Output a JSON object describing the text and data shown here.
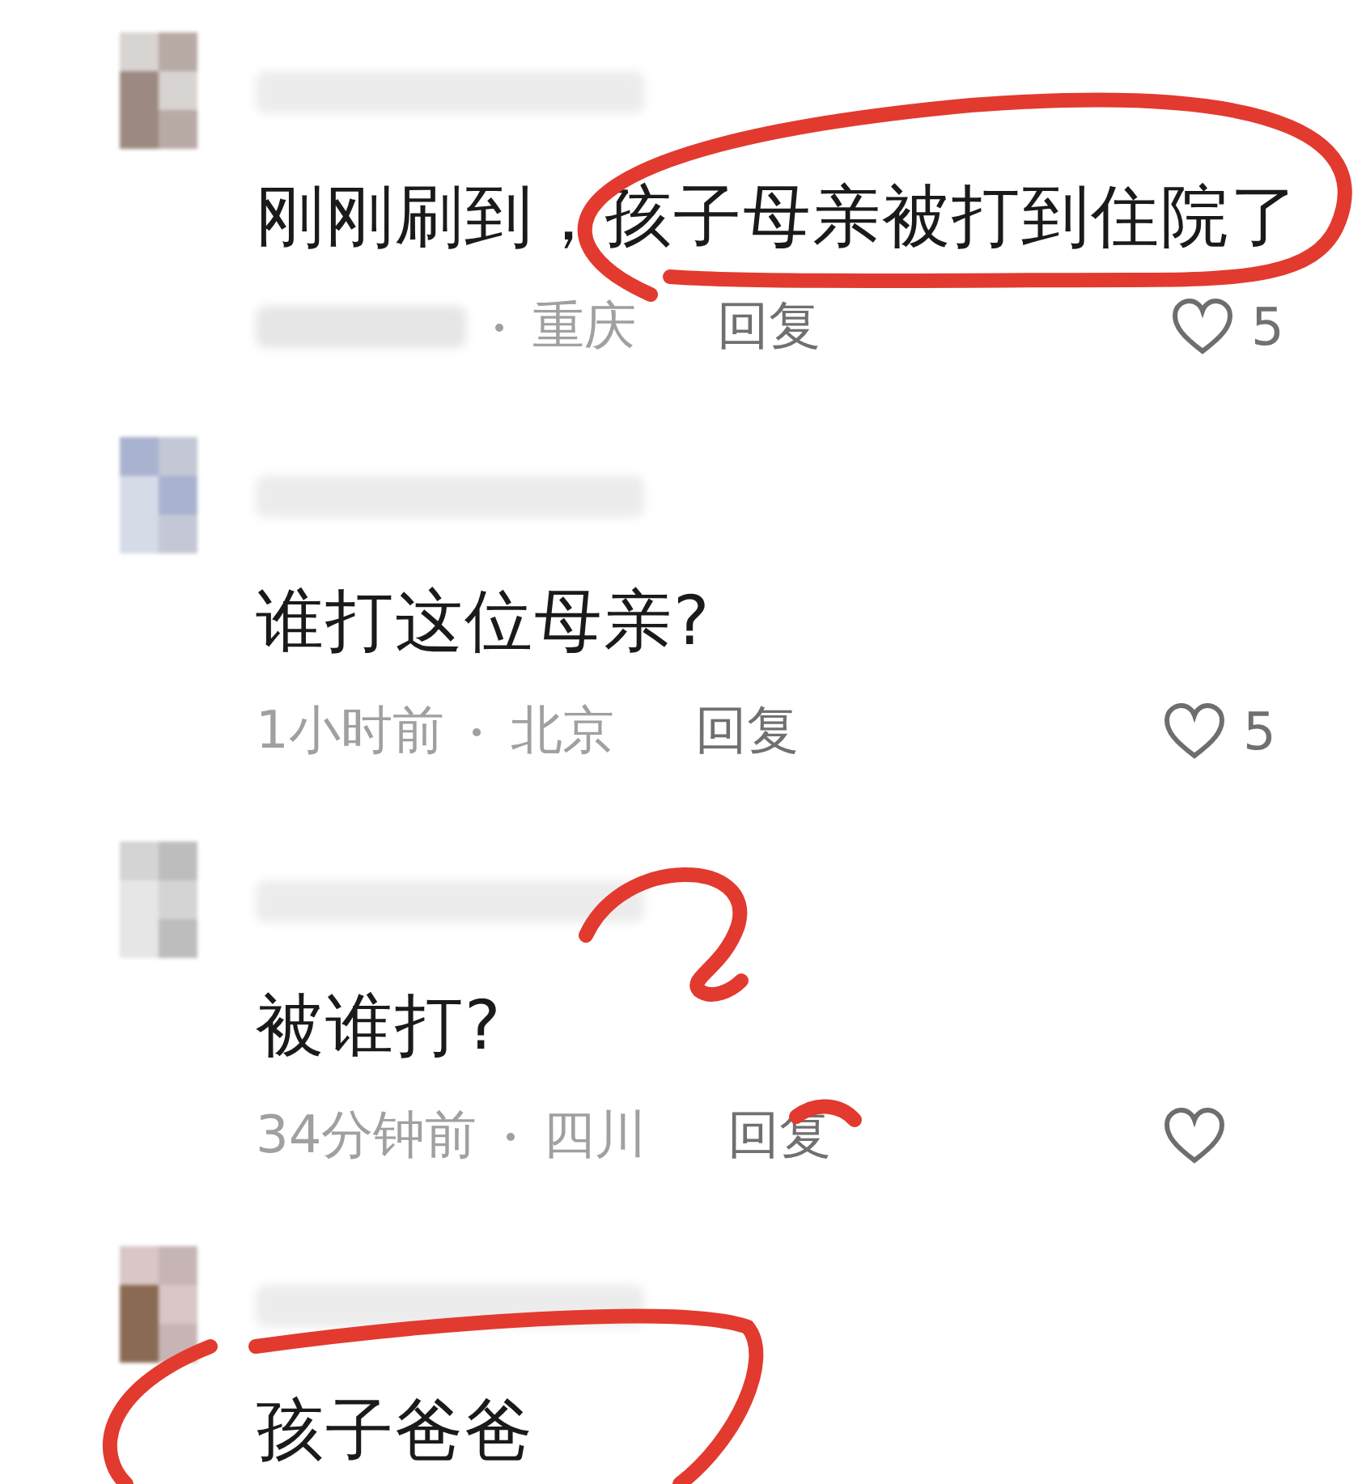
{
  "comments": [
    {
      "text": "刚刚刷到，孩子母亲被打到住院了",
      "location": "重庆",
      "reply": "回复",
      "liked": false,
      "likes": "5"
    },
    {
      "text": "谁打这位母亲?",
      "time": "1小时前",
      "location": "北京",
      "reply": "回复",
      "liked": false,
      "likes": "5"
    },
    {
      "text": "被谁打?",
      "time": "34分钟前",
      "location": "四川",
      "reply": "回复",
      "liked": false
    },
    {
      "text": "孩子爸爸"
    }
  ]
}
